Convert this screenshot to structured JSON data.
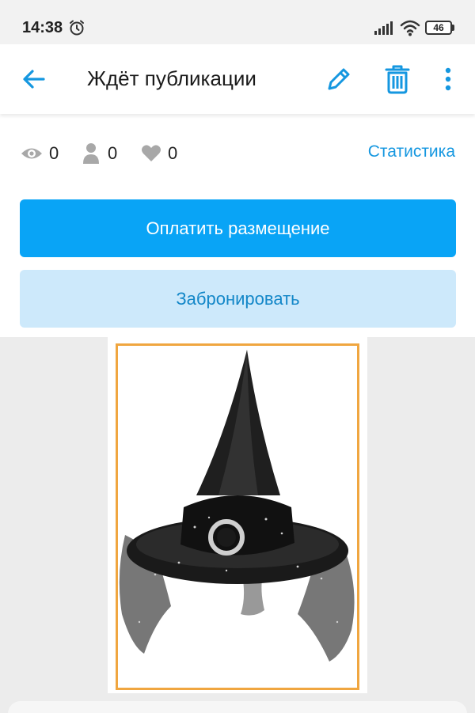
{
  "status_bar": {
    "time": "14:38",
    "battery": "46",
    "icons": [
      "alarm-icon",
      "signal-icon",
      "wifi-icon",
      "battery-icon"
    ]
  },
  "app_bar": {
    "title": "Ждёт публикации",
    "icons": [
      "back-arrow-icon",
      "edit-pencil-icon",
      "trash-icon",
      "more-vertical-icon"
    ],
    "accent_color": "#1597e0"
  },
  "stats": {
    "views": "0",
    "contacts": "0",
    "favorites": "0",
    "link_label": "Статистика"
  },
  "actions": {
    "pay_label": "Оплатить размещение",
    "reserve_label": "Забронировать",
    "primary_color": "#09a4f6",
    "secondary_color": "#cde9fb"
  },
  "listing_photo": {
    "subject": "black witch hat with veil and buckle",
    "frame_color": "#f0a640"
  }
}
